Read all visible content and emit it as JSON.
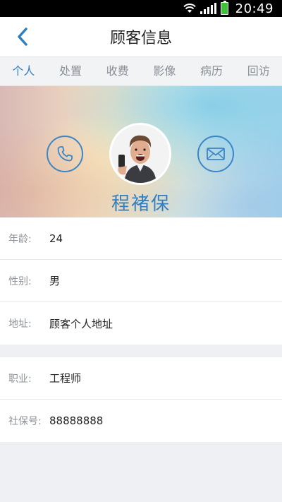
{
  "status_bar": {
    "time": "20:49"
  },
  "header": {
    "title": "顾客信息"
  },
  "tabs": [
    {
      "label": "个人",
      "active": true
    },
    {
      "label": "处置",
      "active": false
    },
    {
      "label": "收费",
      "active": false
    },
    {
      "label": "影像",
      "active": false
    },
    {
      "label": "病历",
      "active": false
    },
    {
      "label": "回访",
      "active": false
    }
  ],
  "profile": {
    "name": "程褚保"
  },
  "info": {
    "age": {
      "label": "年龄:",
      "value": "24"
    },
    "gender": {
      "label": "性别:",
      "value": "男"
    },
    "address": {
      "label": "地址:",
      "value": "顾客个人地址"
    },
    "job": {
      "label": "职业:",
      "value": "工程师"
    },
    "social": {
      "label": "社保号:",
      "value": "88888888"
    }
  },
  "colors": {
    "accent": "#2f7fc1",
    "status_bar": "#000000"
  }
}
